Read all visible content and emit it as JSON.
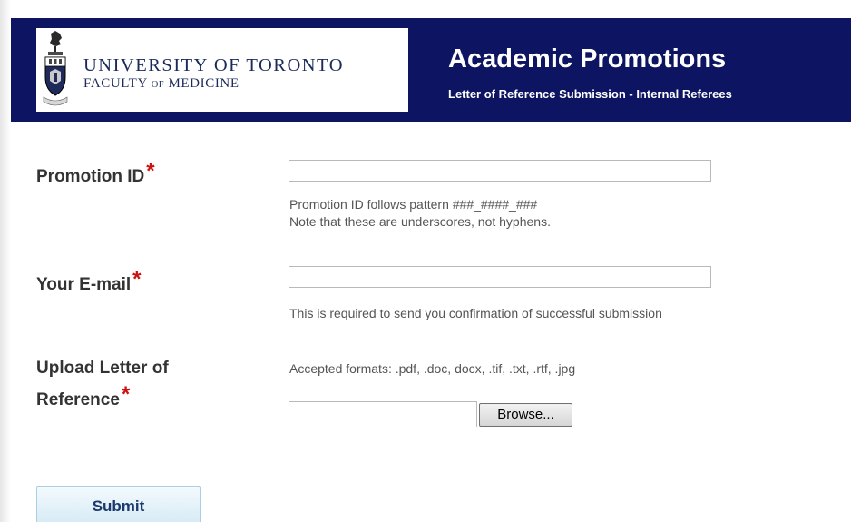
{
  "header": {
    "logo": {
      "university": "UNIVERSITY OF TORONTO",
      "faculty_prefix": "FACULTY",
      "faculty_of": "OF",
      "faculty_suffix": "MEDICINE"
    },
    "title": "Academic Promotions",
    "subtitle": "Letter of Reference Submission - Internal Referees",
    "background_color": "#0d1563"
  },
  "form": {
    "required_marker": "*",
    "required_color": "#cc1111",
    "promotion_id": {
      "label": "Promotion ID",
      "value": "",
      "hint_line1": "Promotion ID follows pattern ###_####_###",
      "hint_line2": "Note that these are underscores, not hyphens."
    },
    "email": {
      "label": "Your E-mail",
      "value": "",
      "hint": "This is required to send you confirmation of successful submission"
    },
    "upload": {
      "label_line1": "Upload Letter of",
      "label_line2": "Reference",
      "hint": "Accepted formats: .pdf, .doc, docx, .tif, .txt, .rtf, .jpg",
      "browse_label": "Browse..."
    },
    "submit_label": "Submit"
  }
}
